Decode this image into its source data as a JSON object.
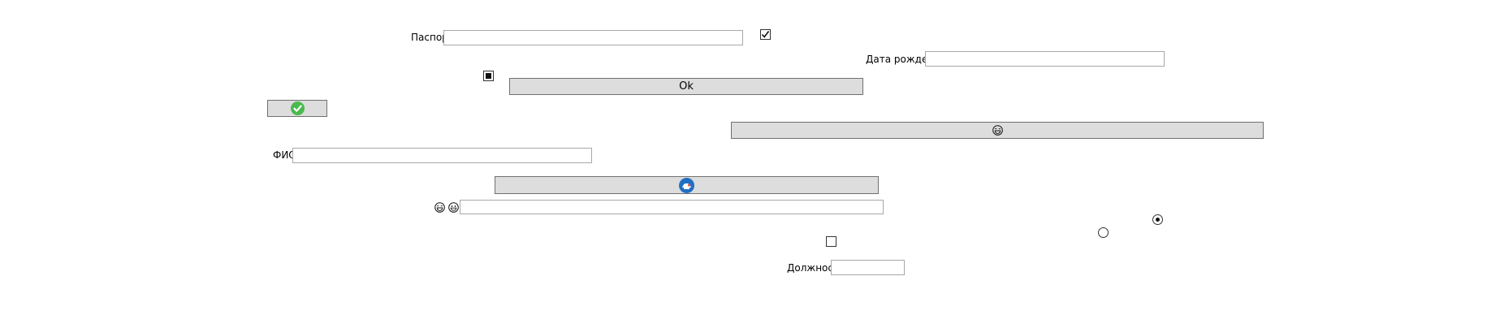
{
  "fields": {
    "passport": {
      "label": "Паспорт",
      "value": ""
    },
    "birth_date": {
      "label": "Дата рождения",
      "value": ""
    },
    "fio": {
      "label": "ФИО",
      "value": ""
    },
    "emoji_text": {
      "value": ""
    },
    "position": {
      "label": "Должность",
      "value": ""
    }
  },
  "buttons": {
    "ok": {
      "label": "Ok"
    },
    "check": {
      "icon": "green-check-circle-icon"
    },
    "emoji": {
      "icon": "laughing-face-icon"
    },
    "blue": {
      "icon": "blue-round-badge-icon"
    }
  },
  "emoji_labels": {
    "first": "😂",
    "second": "😄"
  },
  "checkboxes": {
    "passport_check": "checked",
    "indeterminate": "indeterminate",
    "lower": "unchecked"
  },
  "radios": {
    "first": "selected",
    "second": "unselected"
  },
  "colors": {
    "button_bg": "#dddddd",
    "check_green": "#4ab94e",
    "badge_blue": "#1f6fc4"
  }
}
